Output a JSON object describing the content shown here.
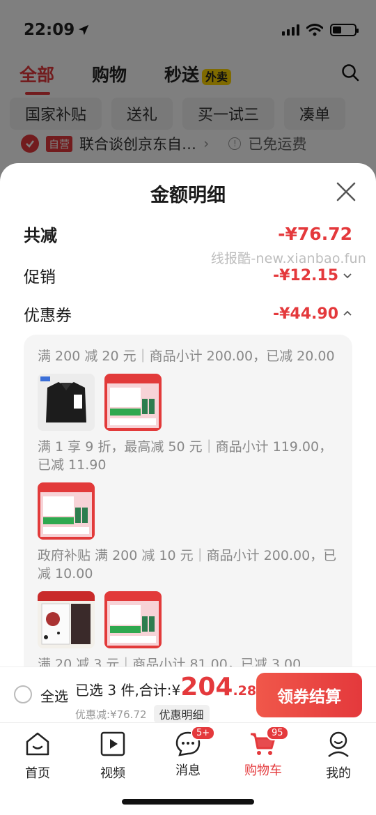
{
  "status_bar": {
    "time": "22:09"
  },
  "top_tabs": [
    {
      "label": "全部",
      "active": true
    },
    {
      "label": "购物",
      "active": false
    },
    {
      "label": "秒送",
      "active": false,
      "badge": "外卖"
    }
  ],
  "chips": [
    "国家补贴",
    "送礼",
    "买一试三",
    "凑单"
  ],
  "store_row": {
    "tag": "自营",
    "name": "联合谈创京东自…",
    "shipping": "已免运费"
  },
  "sheet": {
    "title": "金额明细",
    "watermark": "线报酷-new.xianbao.fun",
    "total_reduce": {
      "label": "共减",
      "amount": "-¥76.72"
    },
    "promo": {
      "label": "促销",
      "amount": "-¥12.15"
    },
    "coupon": {
      "label": "优惠券",
      "amount": "-¥44.90"
    },
    "coupon_groups": [
      {
        "desc": "满 200 减 20 元｜商品小计 200.00，已减 20.00",
        "thumbs": [
          "shirt",
          "medicine"
        ]
      },
      {
        "desc": "满 1 享 9 折，最高减 50 元｜商品小计 119.00，已减 11.90",
        "thumbs": [
          "medicine"
        ]
      },
      {
        "desc": "政府补贴 满 200 减 10 元｜商品小计 200.00，已减 10.00",
        "thumbs": [
          "book",
          "medicine"
        ]
      },
      {
        "desc": "满 20 减 3 元｜商品小计 81.00，已减 3.00",
        "thumbs": []
      }
    ]
  },
  "footer": {
    "select_all": "全选",
    "selected_text": "已选 3 件,合计:",
    "yen": "¥",
    "total_main": "204",
    "total_dec": ".28",
    "discount_text": "优惠减:¥76.72",
    "detail_chip": "优惠明细",
    "checkout": "领券结算"
  },
  "nav": [
    {
      "label": "首页",
      "icon": "home-icon"
    },
    {
      "label": "视频",
      "icon": "video-icon"
    },
    {
      "label": "消息",
      "icon": "message-icon",
      "badge": "5+"
    },
    {
      "label": "购物车",
      "icon": "cart-icon",
      "badge": "95",
      "active": true
    },
    {
      "label": "我的",
      "icon": "profile-icon"
    }
  ],
  "colors": {
    "accent": "#e4393c",
    "overlay": "rgba(0,0,0,0.5)"
  }
}
